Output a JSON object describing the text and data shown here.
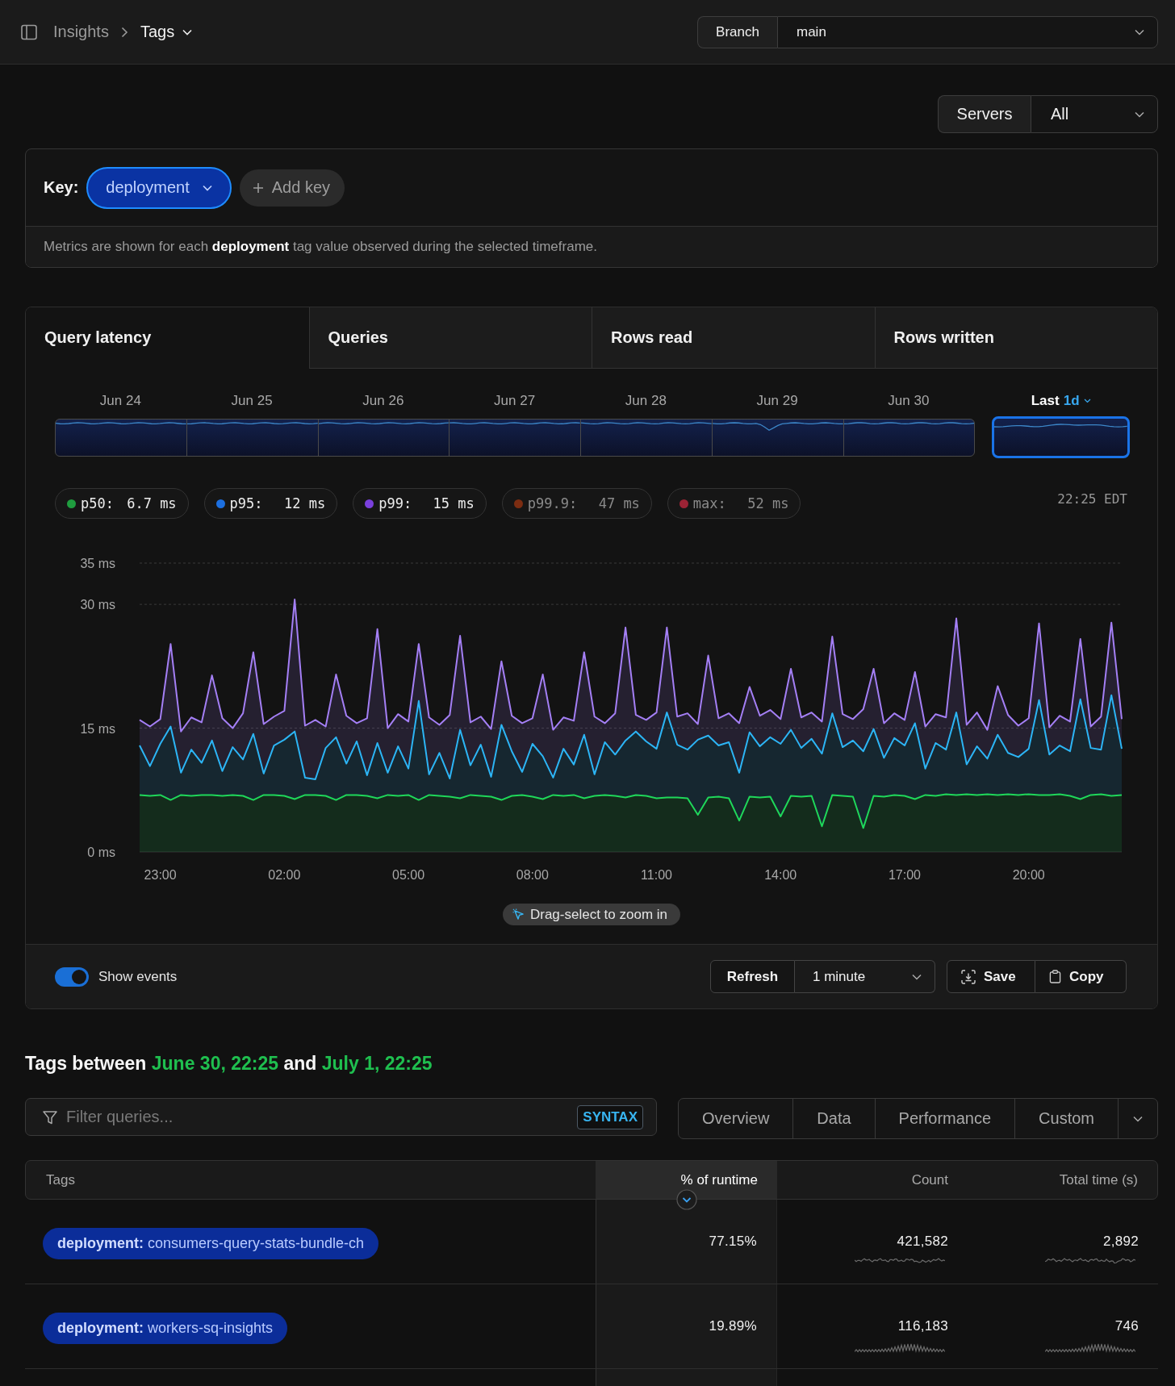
{
  "breadcrumb": [
    {
      "label": "Insights",
      "current": false
    },
    {
      "label": "Tags",
      "current": true
    }
  ],
  "branch": {
    "label": "Branch",
    "value": "main"
  },
  "servers": {
    "label": "Servers",
    "value": "All"
  },
  "key_panel": {
    "label": "Key:",
    "value": "deployment",
    "add_button": "Add key",
    "description": "Metrics are shown for each **deployment** tag value observed during the selected timeframe."
  },
  "metric_tabs": [
    {
      "label": "Query latency",
      "selected": true
    },
    {
      "label": "Queries",
      "selected": false
    },
    {
      "label": "Rows read",
      "selected": false
    },
    {
      "label": "Rows written",
      "selected": false
    }
  ],
  "timeline": [
    {
      "kind": "day",
      "label": "Jun 24",
      "selected": false
    },
    {
      "kind": "day",
      "label": "Jun 25",
      "selected": false
    },
    {
      "kind": "day",
      "label": "Jun 26",
      "selected": false
    },
    {
      "kind": "day",
      "label": "Jun 27",
      "selected": false
    },
    {
      "kind": "day",
      "label": "Jun 28",
      "selected": false
    },
    {
      "kind": "day",
      "label": "Jun 29",
      "selected": false
    },
    {
      "kind": "day",
      "label": "Jun 30",
      "selected": false
    },
    {
      "kind": "range",
      "label": "Last",
      "range": "1d",
      "selected": true
    }
  ],
  "legend": {
    "items": [
      {
        "label": "p50:",
        "value": "6.7 ms",
        "color": "#1f9d3f",
        "on": true
      },
      {
        "label": "p95:",
        "value": "12 ms",
        "color": "#1c6fe0",
        "on": true
      },
      {
        "label": "p99:",
        "value": "15 ms",
        "color": "#7a40dc",
        "on": true
      },
      {
        "label": "p99.9:",
        "value": "47 ms",
        "color": "#7c2d12",
        "on": false
      },
      {
        "label": "max:",
        "value": "52 ms",
        "color": "#9b2335",
        "on": false
      }
    ],
    "timestamp": "22:25 EDT"
  },
  "chart": {
    "chart_data": {
      "type": "area",
      "stacked": false,
      "categories": [
        null,
        null,
        "23:00",
        null,
        null,
        null,
        null,
        null,
        null,
        null,
        null,
        null,
        null,
        null,
        "02:00",
        null,
        null,
        null,
        null,
        null,
        null,
        null,
        null,
        null,
        null,
        null,
        "05:00",
        null,
        null,
        null,
        null,
        null,
        null,
        null,
        null,
        null,
        null,
        null,
        "08:00",
        null,
        null,
        null,
        null,
        null,
        null,
        null,
        null,
        null,
        null,
        null,
        "11:00",
        null,
        null,
        null,
        null,
        null,
        null,
        null,
        null,
        null,
        null,
        null,
        "14:00",
        null,
        null,
        null,
        null,
        null,
        null,
        null,
        null,
        null,
        null,
        null,
        "17:00",
        null,
        null,
        null,
        null,
        null,
        null,
        null,
        null,
        null,
        null,
        null,
        "20:00",
        null,
        null,
        null,
        null,
        null,
        null,
        null,
        null,
        null
      ],
      "series": [
        {
          "color": "#a47ff5",
          "values": [
            16.0,
            15.2,
            16.1,
            25.2,
            14.6,
            16.3,
            15.7,
            21.4,
            16.2,
            15.0,
            16.8,
            24.2,
            15.5,
            16.4,
            17.1,
            30.6,
            15.3,
            16.0,
            15.2,
            21.5,
            16.5,
            15.6,
            16.2,
            27.0,
            15.0,
            16.7,
            15.8,
            25.2,
            16.3,
            15.4,
            16.6,
            26.2,
            15.7,
            16.4,
            14.9,
            23.1,
            16.5,
            15.6,
            16.2,
            21.5,
            14.8,
            16.3,
            15.9,
            24.2,
            16.4,
            15.6,
            16.8,
            27.2,
            16.6,
            16.0,
            16.9,
            27.2,
            16.4,
            16.8,
            15.5,
            23.8,
            16.2,
            16.8,
            15.6,
            20.0,
            16.5,
            17.2,
            16.1,
            22.2,
            16.3,
            16.9,
            15.8,
            26.1,
            16.7,
            16.1,
            17.3,
            22.2,
            15.6,
            16.8,
            16.0,
            21.8,
            15.2,
            16.7,
            16.3,
            28.3,
            15.4,
            16.9,
            14.8,
            20.1,
            16.6,
            15.3,
            16.2,
            27.7,
            15.1,
            16.5,
            15.8,
            25.8,
            15.2,
            16.4,
            27.8,
            16.1
          ]
        },
        {
          "color": "#2cb5f5",
          "values": [
            12.9,
            10.4,
            13.1,
            15.2,
            9.6,
            12.4,
            10.8,
            13.5,
            9.8,
            12.7,
            11.2,
            14.3,
            9.5,
            12.9,
            13.6,
            14.6,
            9.0,
            8.8,
            12.6,
            13.9,
            10.7,
            13.4,
            9.3,
            13.2,
            9.6,
            12.8,
            10.1,
            18.3,
            9.4,
            12.0,
            8.9,
            14.8,
            10.5,
            13.0,
            9.1,
            15.4,
            12.2,
            9.7,
            13.1,
            11.6,
            9.0,
            12.5,
            10.6,
            14.2,
            9.4,
            13.3,
            11.8,
            13.5,
            14.6,
            13.4,
            12.5,
            16.9,
            13.0,
            12.4,
            13.6,
            14.1,
            12.9,
            13.3,
            9.6,
            14.5,
            12.8,
            13.9,
            13.1,
            14.8,
            12.6,
            13.7,
            11.9,
            16.8,
            12.7,
            13.5,
            12.2,
            14.9,
            11.4,
            13.8,
            12.9,
            15.6,
            10.1,
            13.2,
            12.4,
            16.9,
            10.6,
            12.8,
            11.3,
            14.2,
            12.0,
            11.5,
            12.5,
            18.4,
            11.8,
            12.9,
            12.2,
            18.5,
            12.6,
            12.4,
            19.0,
            12.5
          ]
        },
        {
          "color": "#1fd75a",
          "values": [
            6.9,
            6.8,
            6.9,
            6.3,
            6.9,
            6.8,
            6.9,
            6.9,
            6.8,
            6.9,
            6.8,
            6.3,
            6.9,
            6.9,
            6.8,
            6.4,
            6.9,
            6.9,
            6.8,
            6.3,
            6.9,
            6.9,
            6.8,
            6.5,
            6.9,
            6.8,
            6.9,
            6.3,
            6.9,
            6.8,
            6.7,
            6.5,
            6.9,
            6.8,
            6.7,
            6.3,
            6.8,
            6.9,
            6.7,
            6.4,
            6.9,
            6.8,
            6.9,
            6.5,
            6.8,
            6.9,
            6.8,
            6.6,
            6.9,
            6.8,
            6.5,
            6.6,
            6.6,
            6.5,
            4.5,
            6.6,
            6.7,
            6.5,
            3.8,
            6.7,
            6.6,
            6.7,
            4.3,
            6.8,
            6.7,
            6.8,
            3.1,
            6.9,
            6.8,
            6.7,
            2.9,
            6.8,
            6.7,
            6.9,
            6.8,
            6.4,
            6.9,
            6.8,
            7.0,
            6.9,
            7.0,
            6.9,
            7.0,
            6.9,
            7.0,
            6.9,
            7.0,
            6.9,
            6.9,
            7.0,
            6.8,
            6.4,
            6.9,
            7.0,
            6.8,
            6.9
          ]
        }
      ],
      "ylim": [
        0,
        35
      ],
      "yticks": [
        {
          "value": 0,
          "label": "0 ms"
        },
        {
          "value": 15,
          "label": "15 ms"
        },
        {
          "value": 30,
          "label": "30 ms"
        },
        {
          "value": 35,
          "label": "35 ms"
        }
      ]
    },
    "hint": "Drag-select to zoom in"
  },
  "controls": {
    "show_events": {
      "label": "Show events",
      "on": true
    },
    "refresh": {
      "label": "Refresh",
      "interval": "1 minute"
    },
    "actions": [
      {
        "kind": "save",
        "label": "Save"
      },
      {
        "kind": "copy",
        "label": "Copy"
      }
    ]
  },
  "tags_heading": {
    "prefix": "Tags between",
    "start": "June 30, 22:25",
    "joiner": "and",
    "end": "July 1, 22:25"
  },
  "filter": {
    "placeholder": "Filter queries...",
    "syntax": "SYNTAX"
  },
  "views": [
    {
      "label": "Overview",
      "selected": false
    },
    {
      "label": "Data",
      "selected": false
    },
    {
      "label": "Performance",
      "selected": false
    },
    {
      "label": "Custom",
      "selected": false
    }
  ],
  "table": {
    "columns": [
      {
        "label": "Tags",
        "sorted": false
      },
      {
        "label": "% of runtime",
        "sorted": true
      },
      {
        "label": "Count",
        "sorted": false
      },
      {
        "label": "Total time (s)",
        "sorted": false
      }
    ],
    "rows": [
      {
        "tag": "**deployment:** consumers-query-stats-bundle-ch",
        "runtime": "77.15%",
        "count": "421,582",
        "total_time": "2,892"
      },
      {
        "tag": "**deployment:** workers-sq-insights",
        "runtime": "19.89%",
        "count": "116,183",
        "total_time": "746"
      }
    ]
  }
}
